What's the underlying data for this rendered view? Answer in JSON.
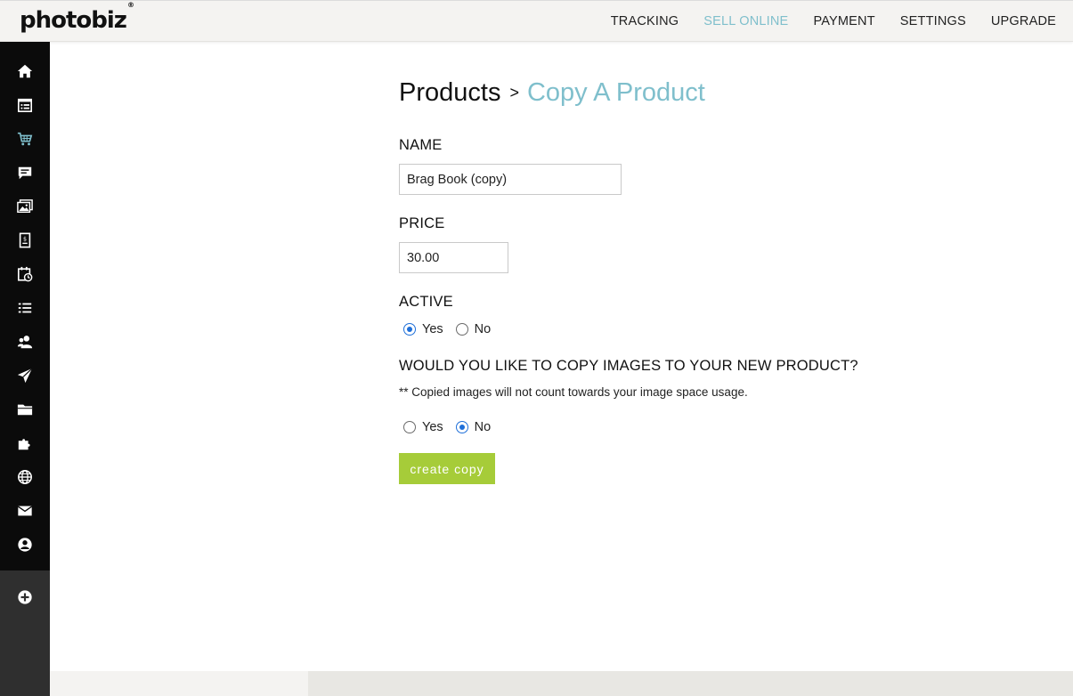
{
  "brand": {
    "logo_text": "photobiz",
    "logo_mark": "®"
  },
  "topnav": {
    "items": [
      {
        "label": "TRACKING",
        "active": false
      },
      {
        "label": "SELL ONLINE",
        "active": true
      },
      {
        "label": "PAYMENT",
        "active": false
      },
      {
        "label": "SETTINGS",
        "active": false
      },
      {
        "label": "UPGRADE",
        "active": false
      }
    ]
  },
  "sidebar": {
    "icons": [
      "home-icon",
      "calendar-list-icon",
      "cart-icon",
      "chat-icon",
      "gallery-icon",
      "invoice-icon",
      "appointment-icon",
      "list-icon",
      "users-icon",
      "send-icon",
      "folder-icon",
      "puzzle-icon",
      "globe-icon",
      "mail-icon",
      "account-icon"
    ],
    "active_icon": "cart-icon",
    "add_icon": "add-icon"
  },
  "breadcrumb": {
    "parent": "Products",
    "separator": ">",
    "current": "Copy A Product"
  },
  "form": {
    "name_label": "NAME",
    "name_value": "Brag Book (copy)",
    "price_label": "PRICE",
    "price_value": "30.00",
    "active_label": "ACTIVE",
    "active_options": [
      "Yes",
      "No"
    ],
    "active_selected": "Yes",
    "copy_images_label": "WOULD YOU LIKE TO COPY IMAGES TO YOUR NEW PRODUCT?",
    "copy_images_note": "** Copied images will not count towards your image space usage.",
    "copy_images_options": [
      "Yes",
      "No"
    ],
    "copy_images_selected": "No",
    "submit_label": "create copy"
  },
  "colors": {
    "accent": "#7fbfcc",
    "button": "#a6cc39",
    "sidebar": "#0b0b0b",
    "radio": "#1e6fd9"
  }
}
